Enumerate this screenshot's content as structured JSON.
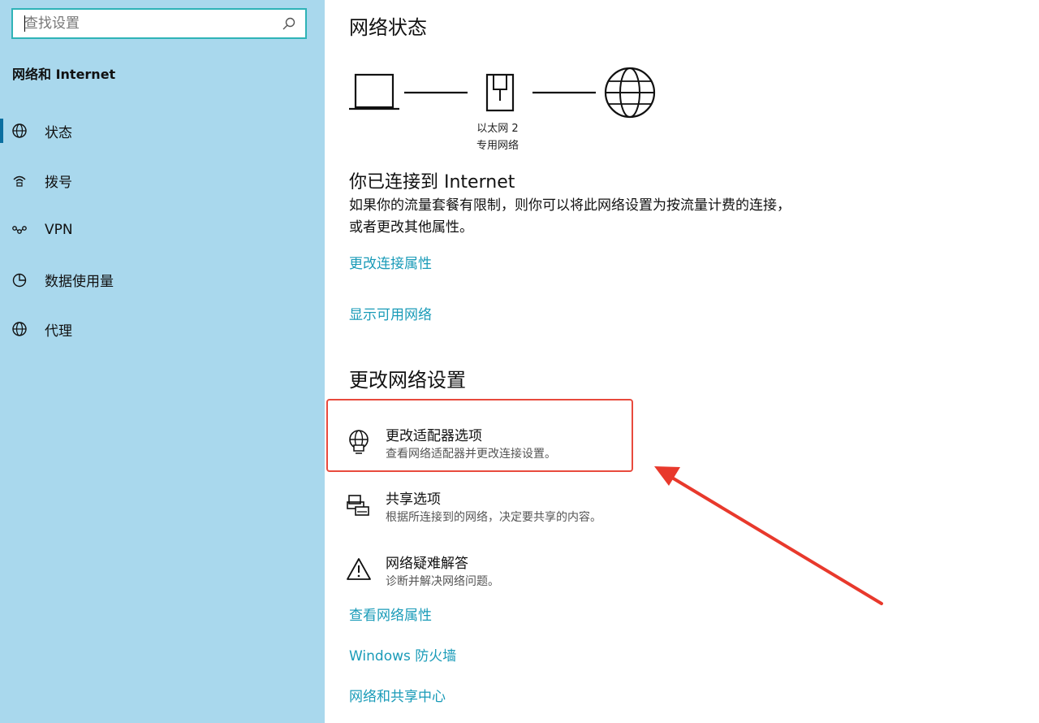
{
  "sidebar": {
    "search_placeholder": "查找设置",
    "section_title": "网络和 Internet",
    "items": [
      {
        "label": "状态",
        "icon": "status-globe-icon"
      },
      {
        "label": "拨号",
        "icon": "dialup-icon"
      },
      {
        "label": "VPN",
        "icon": "vpn-icon"
      },
      {
        "label": "数据使用量",
        "icon": "data-usage-icon"
      },
      {
        "label": "代理",
        "icon": "proxy-globe-icon"
      }
    ]
  },
  "main": {
    "status_title": "网络状态",
    "ethernet_name": "以太网 2",
    "network_type": "专用网络",
    "connected_title": "你已连接到 Internet",
    "connected_desc": "如果你的流量套餐有限制，则你可以将此网络设置为按流量计费的连接，或者更改其他属性。",
    "links_top": [
      "更改连接属性",
      "显示可用网络"
    ],
    "change_title": "更改网络设置",
    "options": [
      {
        "title": "更改适配器选项",
        "desc": "查看网络适配器并更改连接设置。",
        "icon": "adapter-globe-icon"
      },
      {
        "title": "共享选项",
        "desc": "根据所连接到的网络，决定要共享的内容。",
        "icon": "sharing-icon"
      },
      {
        "title": "网络疑难解答",
        "desc": "诊断并解决网络问题。",
        "icon": "warning-icon"
      }
    ],
    "links_bottom": [
      "查看网络属性",
      "Windows 防火墙",
      "网络和共享中心"
    ]
  },
  "colors": {
    "sidebar_bg": "#a9d8ed",
    "accent_link": "#1a9bb8",
    "search_border": "#2fb3b7",
    "highlight_red": "#e84a3d"
  }
}
